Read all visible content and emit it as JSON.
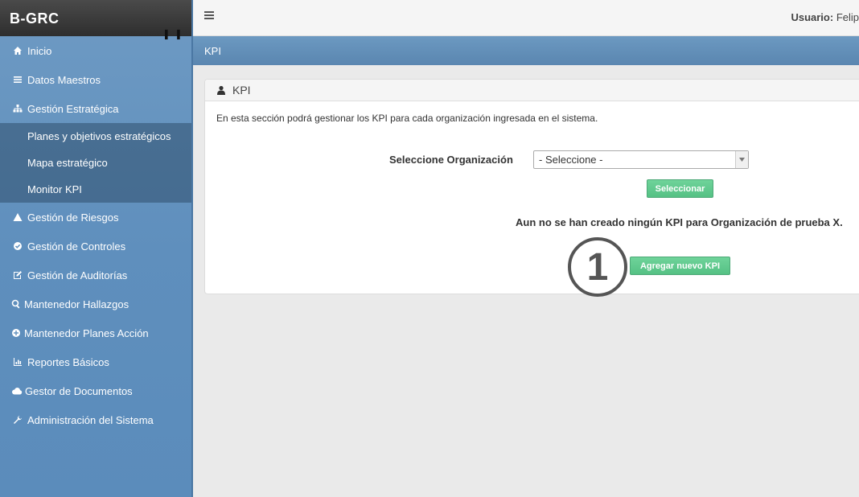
{
  "brand": "B-GRC",
  "brand_marks": "▌▌",
  "topbar": {
    "user_label": "Usuario:",
    "user_name": "Felip"
  },
  "sidebar": {
    "items": [
      {
        "label": "Inicio",
        "icon": "home-icon"
      },
      {
        "label": "Datos Maestros",
        "icon": "list-icon"
      },
      {
        "label": "Gestión Estratégica",
        "icon": "sitemap-icon"
      },
      {
        "label": "Gestión de Riesgos",
        "icon": "warning-icon"
      },
      {
        "label": "Gestión de Controles",
        "icon": "check-circle-icon"
      },
      {
        "label": "Gestión de Auditorías",
        "icon": "edit-icon"
      },
      {
        "label": "Mantenedor Hallazgos",
        "icon": "search-icon"
      },
      {
        "label": "Mantenedor Planes Acción",
        "icon": "plus-circle-icon"
      },
      {
        "label": "Reportes Básicos",
        "icon": "bar-chart-icon"
      },
      {
        "label": "Gestor de Documentos",
        "icon": "cloud-icon"
      },
      {
        "label": "Administración del Sistema",
        "icon": "wrench-icon"
      }
    ],
    "submenu": [
      {
        "label": "Planes y objetivos estratégicos"
      },
      {
        "label": "Mapa estratégico"
      },
      {
        "label": "Monitor KPI"
      }
    ]
  },
  "page_header": {
    "title": "KPI"
  },
  "panel": {
    "title": "KPI",
    "intro": "En esta sección podrá gestionar los KPI para cada organización ingresada en el sistema.",
    "org_label": "Seleccione Organización",
    "select_value": "- Seleccione -",
    "select_button": "Seleccionar",
    "notice": "Aun no se han creado ningún KPI para Organización de prueba X.",
    "add_button": "Agregar nuevo KPI"
  },
  "annotation": {
    "number": "1"
  },
  "colors": {
    "sidebar": "#5f8fbd",
    "header_band": "#5a86b0",
    "button_green": "#55c184",
    "brand_bar": "#2e2e2e"
  }
}
